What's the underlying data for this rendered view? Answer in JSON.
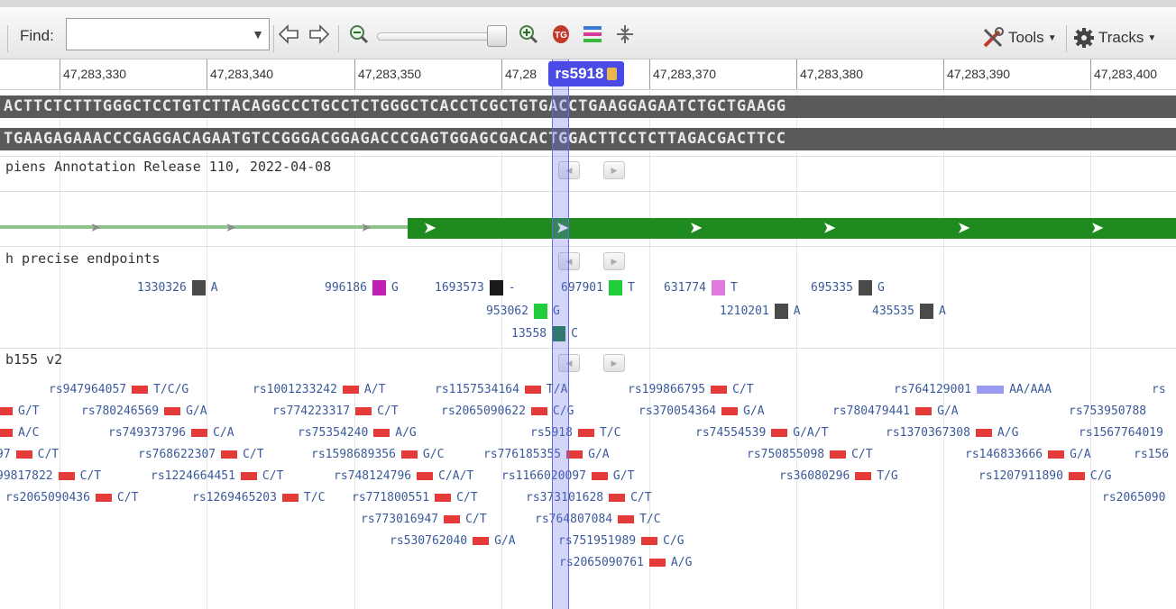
{
  "toolbar": {
    "find_label": "Find:",
    "find_value": "",
    "tools_label": "Tools",
    "tracks_label": "Tracks"
  },
  "ruler": {
    "ticks": [
      "47,283,330",
      "47,283,340",
      "47,283,350",
      "47,28",
      "47,283,370",
      "47,283,380",
      "47,283,390",
      "47,283,400"
    ]
  },
  "selected_snp": {
    "id": "rs5918"
  },
  "sequence": {
    "forward": "ACTTCTCTTTGGGCTCCTGTCTTACAGGCCCTGCCTCTGGGCTCACCTCGCTGTGACCTGAAGGAGAATCTGCTGAAGG",
    "reverse": "TGAAGAGAAACCCGAGGACAGAATGTCCGGGACGGAGACCCGAGTGGAGCGACACTGGACTTCCTCTTAGACGACTTCC"
  },
  "tracks": {
    "annotation_title": "piens Annotation Release 110, 2022-04-08",
    "clinvar_title": "h precise endpoints",
    "dbsnp_title": "b155 v2"
  },
  "clinvar_features": [
    {
      "id": "1330326",
      "allele": "A",
      "color": "#4a4a4a"
    },
    {
      "id": "996186",
      "allele": "G",
      "color": "#c21fb4"
    },
    {
      "id": "1693573",
      "allele": "-",
      "color": "#1a1a1a"
    },
    {
      "id": "697901",
      "allele": "T",
      "color": "#1fcc3a"
    },
    {
      "id": "631774",
      "allele": "T",
      "color": "#e07ae0"
    },
    {
      "id": "695335",
      "allele": "G",
      "color": "#4a4a4a"
    },
    {
      "id": "953062",
      "allele": "G",
      "color": "#1fcc3a"
    },
    {
      "id": "1210201",
      "allele": "A",
      "color": "#4a4a4a"
    },
    {
      "id": "435535",
      "allele": "A",
      "color": "#4a4a4a"
    },
    {
      "id": "13558",
      "allele": "C",
      "color": "#167a3a"
    }
  ],
  "snps": [
    {
      "id": "rs947964057",
      "allele": "T/C/G"
    },
    {
      "id": "rs1001233242",
      "allele": "A/T"
    },
    {
      "id": "rs1157534164",
      "allele": "T/A"
    },
    {
      "id": "rs199866795",
      "allele": "C/T"
    },
    {
      "id": "rs764129001",
      "allele": "AA/AAA"
    },
    {
      "id": "rs",
      "allele": ""
    },
    {
      "id": "",
      "allele": "G/T"
    },
    {
      "id": "rs780246569",
      "allele": "G/A"
    },
    {
      "id": "rs774223317",
      "allele": "C/T"
    },
    {
      "id": "rs2065090622",
      "allele": "C/G"
    },
    {
      "id": "rs370054364",
      "allele": "G/A"
    },
    {
      "id": "rs780479441",
      "allele": "G/A"
    },
    {
      "id": "rs753950788",
      "allele": ""
    },
    {
      "id": "",
      "allele": "A/C"
    },
    {
      "id": "rs749373796",
      "allele": "C/A"
    },
    {
      "id": "rs75354240",
      "allele": "A/G"
    },
    {
      "id": "rs5918",
      "allele": "T/C"
    },
    {
      "id": "rs74554539",
      "allele": "G/A/T"
    },
    {
      "id": "rs1370367308",
      "allele": "A/G"
    },
    {
      "id": "rs1567764019",
      "allele": ""
    },
    {
      "id": "97",
      "allele": "C/T"
    },
    {
      "id": "rs768622307",
      "allele": "C/T"
    },
    {
      "id": "rs1598689356",
      "allele": "G/C"
    },
    {
      "id": "rs776185355",
      "allele": "G/A"
    },
    {
      "id": "rs750855098",
      "allele": "C/T"
    },
    {
      "id": "rs146833666",
      "allele": "G/A"
    },
    {
      "id": "rs156",
      "allele": ""
    },
    {
      "id": "99817822",
      "allele": "C/T"
    },
    {
      "id": "rs1224664451",
      "allele": "C/T"
    },
    {
      "id": "rs748124796",
      "allele": "C/A/T"
    },
    {
      "id": "rs1166020097",
      "allele": "G/T"
    },
    {
      "id": "rs36080296",
      "allele": "T/G"
    },
    {
      "id": "rs1207911890",
      "allele": "C/G"
    },
    {
      "id": "rs2065090436",
      "allele": "C/T"
    },
    {
      "id": "rs1269465203",
      "allele": "T/C"
    },
    {
      "id": "rs771800551",
      "allele": "C/T"
    },
    {
      "id": "rs373101628",
      "allele": "C/T"
    },
    {
      "id": "rs2065090",
      "allele": ""
    },
    {
      "id": "rs773016947",
      "allele": "C/T"
    },
    {
      "id": "rs764807084",
      "allele": "T/C"
    },
    {
      "id": "rs530762040",
      "allele": "G/A"
    },
    {
      "id": "rs751951989",
      "allele": "C/G"
    },
    {
      "id": "rs2065090761",
      "allele": "A/G"
    }
  ]
}
